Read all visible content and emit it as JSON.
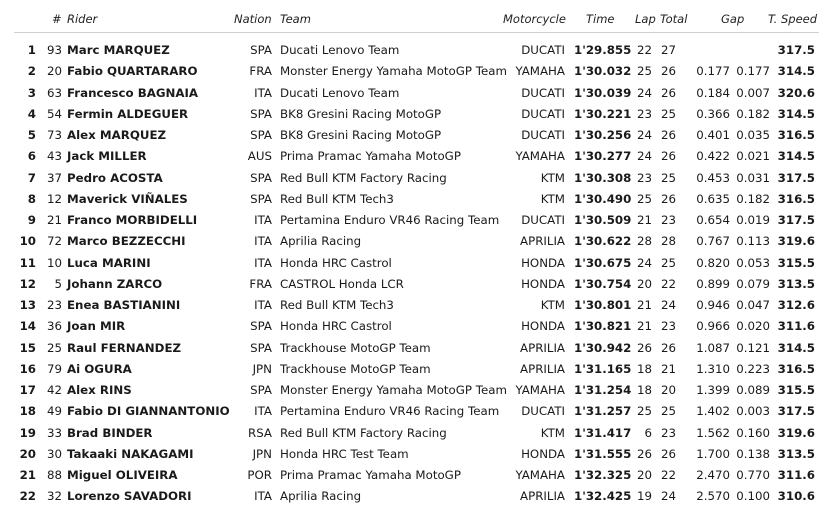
{
  "headers": {
    "hash": "#",
    "rider": "Rider",
    "nation": "Nation",
    "team": "Team",
    "motorcycle": "Motorcycle",
    "time": "Time",
    "lap": "Lap",
    "total": "Total",
    "gap": "Gap",
    "speed": "T. Speed"
  },
  "rows": [
    {
      "pos": "1",
      "num": "93",
      "rider": "Marc MARQUEZ",
      "nation": "SPA",
      "team": "Ducati Lenovo Team",
      "moto": "DUCATI",
      "time": "1'29.855",
      "lap": "22",
      "total": "27",
      "gap1": "",
      "gap2": "",
      "speed": "317.5"
    },
    {
      "pos": "2",
      "num": "20",
      "rider": "Fabio QUARTARARO",
      "nation": "FRA",
      "team": "Monster Energy Yamaha MotoGP Team",
      "moto": "YAMAHA",
      "time": "1'30.032",
      "lap": "25",
      "total": "26",
      "gap1": "0.177",
      "gap2": "0.177",
      "speed": "314.5"
    },
    {
      "pos": "3",
      "num": "63",
      "rider": "Francesco BAGNAIA",
      "nation": "ITA",
      "team": "Ducati Lenovo Team",
      "moto": "DUCATI",
      "time": "1'30.039",
      "lap": "24",
      "total": "26",
      "gap1": "0.184",
      "gap2": "0.007",
      "speed": "320.6"
    },
    {
      "pos": "4",
      "num": "54",
      "rider": "Fermin ALDEGUER",
      "nation": "SPA",
      "team": "BK8 Gresini Racing MotoGP",
      "moto": "DUCATI",
      "time": "1'30.221",
      "lap": "23",
      "total": "25",
      "gap1": "0.366",
      "gap2": "0.182",
      "speed": "314.5"
    },
    {
      "pos": "5",
      "num": "73",
      "rider": "Alex MARQUEZ",
      "nation": "SPA",
      "team": "BK8 Gresini Racing MotoGP",
      "moto": "DUCATI",
      "time": "1'30.256",
      "lap": "24",
      "total": "26",
      "gap1": "0.401",
      "gap2": "0.035",
      "speed": "316.5"
    },
    {
      "pos": "6",
      "num": "43",
      "rider": "Jack MILLER",
      "nation": "AUS",
      "team": "Prima Pramac Yamaha MotoGP",
      "moto": "YAMAHA",
      "time": "1'30.277",
      "lap": "24",
      "total": "26",
      "gap1": "0.422",
      "gap2": "0.021",
      "speed": "314.5"
    },
    {
      "pos": "7",
      "num": "37",
      "rider": "Pedro ACOSTA",
      "nation": "SPA",
      "team": "Red Bull KTM Factory Racing",
      "moto": "KTM",
      "time": "1'30.308",
      "lap": "23",
      "total": "25",
      "gap1": "0.453",
      "gap2": "0.031",
      "speed": "317.5"
    },
    {
      "pos": "8",
      "num": "12",
      "rider": "Maverick VIÑALES",
      "nation": "SPA",
      "team": "Red Bull KTM Tech3",
      "moto": "KTM",
      "time": "1'30.490",
      "lap": "25",
      "total": "26",
      "gap1": "0.635",
      "gap2": "0.182",
      "speed": "316.5"
    },
    {
      "pos": "9",
      "num": "21",
      "rider": "Franco MORBIDELLI",
      "nation": "ITA",
      "team": "Pertamina Enduro VR46 Racing Team",
      "moto": "DUCATI",
      "time": "1'30.509",
      "lap": "21",
      "total": "23",
      "gap1": "0.654",
      "gap2": "0.019",
      "speed": "317.5"
    },
    {
      "pos": "10",
      "num": "72",
      "rider": "Marco BEZZECCHI",
      "nation": "ITA",
      "team": "Aprilia Racing",
      "moto": "APRILIA",
      "time": "1'30.622",
      "lap": "28",
      "total": "28",
      "gap1": "0.767",
      "gap2": "0.113",
      "speed": "319.6"
    },
    {
      "pos": "11",
      "num": "10",
      "rider": "Luca MARINI",
      "nation": "ITA",
      "team": "Honda HRC Castrol",
      "moto": "HONDA",
      "time": "1'30.675",
      "lap": "24",
      "total": "25",
      "gap1": "0.820",
      "gap2": "0.053",
      "speed": "315.5"
    },
    {
      "pos": "12",
      "num": "5",
      "rider": "Johann ZARCO",
      "nation": "FRA",
      "team": "CASTROL Honda LCR",
      "moto": "HONDA",
      "time": "1'30.754",
      "lap": "20",
      "total": "22",
      "gap1": "0.899",
      "gap2": "0.079",
      "speed": "313.5"
    },
    {
      "pos": "13",
      "num": "23",
      "rider": "Enea BASTIANINI",
      "nation": "ITA",
      "team": "Red Bull KTM Tech3",
      "moto": "KTM",
      "time": "1'30.801",
      "lap": "21",
      "total": "24",
      "gap1": "0.946",
      "gap2": "0.047",
      "speed": "312.6"
    },
    {
      "pos": "14",
      "num": "36",
      "rider": "Joan MIR",
      "nation": "SPA",
      "team": "Honda HRC Castrol",
      "moto": "HONDA",
      "time": "1'30.821",
      "lap": "21",
      "total": "23",
      "gap1": "0.966",
      "gap2": "0.020",
      "speed": "311.6"
    },
    {
      "pos": "15",
      "num": "25",
      "rider": "Raul FERNANDEZ",
      "nation": "SPA",
      "team": "Trackhouse MotoGP Team",
      "moto": "APRILIA",
      "time": "1'30.942",
      "lap": "26",
      "total": "26",
      "gap1": "1.087",
      "gap2": "0.121",
      "speed": "314.5"
    },
    {
      "pos": "16",
      "num": "79",
      "rider": "Ai OGURA",
      "nation": "JPN",
      "team": "Trackhouse MotoGP Team",
      "moto": "APRILIA",
      "time": "1'31.165",
      "lap": "18",
      "total": "21",
      "gap1": "1.310",
      "gap2": "0.223",
      "speed": "316.5"
    },
    {
      "pos": "17",
      "num": "42",
      "rider": "Alex RINS",
      "nation": "SPA",
      "team": "Monster Energy Yamaha MotoGP Team",
      "moto": "YAMAHA",
      "time": "1'31.254",
      "lap": "18",
      "total": "20",
      "gap1": "1.399",
      "gap2": "0.089",
      "speed": "315.5"
    },
    {
      "pos": "18",
      "num": "49",
      "rider": "Fabio DI GIANNANTONIO",
      "nation": "ITA",
      "team": "Pertamina Enduro VR46 Racing Team",
      "moto": "DUCATI",
      "time": "1'31.257",
      "lap": "25",
      "total": "25",
      "gap1": "1.402",
      "gap2": "0.003",
      "speed": "317.5"
    },
    {
      "pos": "19",
      "num": "33",
      "rider": "Brad BINDER",
      "nation": "RSA",
      "team": "Red Bull KTM Factory Racing",
      "moto": "KTM",
      "time": "1'31.417",
      "lap": "6",
      "total": "23",
      "gap1": "1.562",
      "gap2": "0.160",
      "speed": "319.6"
    },
    {
      "pos": "20",
      "num": "30",
      "rider": "Takaaki NAKAGAMI",
      "nation": "JPN",
      "team": "Honda HRC Test Team",
      "moto": "HONDA",
      "time": "1'31.555",
      "lap": "26",
      "total": "26",
      "gap1": "1.700",
      "gap2": "0.138",
      "speed": "313.5"
    },
    {
      "pos": "21",
      "num": "88",
      "rider": "Miguel OLIVEIRA",
      "nation": "POR",
      "team": "Prima Pramac Yamaha MotoGP",
      "moto": "YAMAHA",
      "time": "1'32.325",
      "lap": "20",
      "total": "22",
      "gap1": "2.470",
      "gap2": "0.770",
      "speed": "311.6"
    },
    {
      "pos": "22",
      "num": "32",
      "rider": "Lorenzo SAVADORI",
      "nation": "ITA",
      "team": "Aprilia Racing",
      "moto": "APRILIA",
      "time": "1'32.425",
      "lap": "19",
      "total": "24",
      "gap1": "2.570",
      "gap2": "0.100",
      "speed": "310.6"
    }
  ]
}
